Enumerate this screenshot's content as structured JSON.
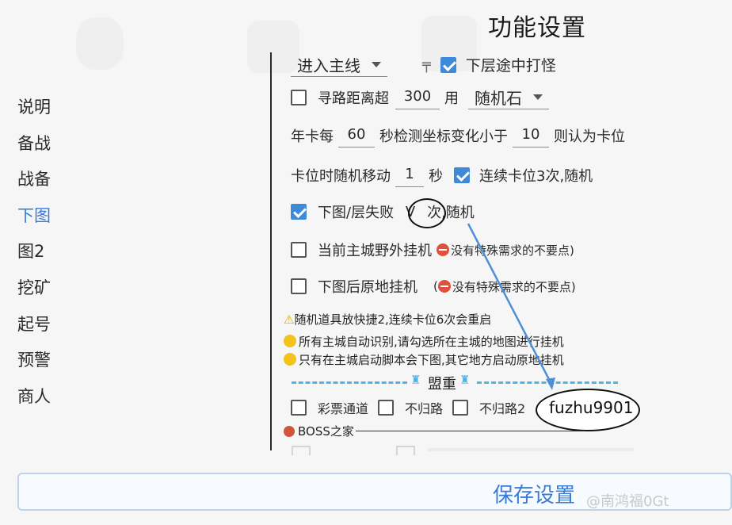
{
  "page": {
    "title": "功能设置"
  },
  "sidebar": {
    "items": [
      {
        "label": "说明"
      },
      {
        "label": "备战"
      },
      {
        "label": "战备"
      },
      {
        "label": "下图"
      },
      {
        "label": "图2"
      },
      {
        "label": "挖矿"
      },
      {
        "label": "起号"
      },
      {
        "label": "预警"
      },
      {
        "label": "商人"
      }
    ],
    "active_index": 3
  },
  "form": {
    "mode_select": {
      "value": "进入主线"
    },
    "fight_midway": {
      "label": "下层途中打怪",
      "checked": true
    },
    "pathfind": {
      "checked": false,
      "label_prefix": "寻路距离超",
      "distance": "300",
      "label_use": "用",
      "item": "随机石"
    },
    "stuck_detect": {
      "prefix": "年卡每",
      "seconds": "60",
      "middle": "秒检测坐标变化小于",
      "threshold": "10",
      "suffix": "则认为卡位"
    },
    "stuck_move": {
      "prefix": "卡位时随机移动",
      "seconds": "1",
      "unit": "秒",
      "consecutive": {
        "label": "连续卡位3次,随机",
        "checked": true
      }
    },
    "map_fail": {
      "checked": true,
      "label_prefix": "下图/层失败",
      "value": "V",
      "label_suffix": "次,随机"
    },
    "wild_afk": {
      "checked": false,
      "label": "当前主城野外挂机",
      "hint": "没有特殊需求的不要点)"
    },
    "stay_afk": {
      "checked": false,
      "label": "下图后原地挂机",
      "hint": "没有特殊需求的不要点)",
      "hint_prefix": "("
    },
    "notes": [
      "随机道具放快捷2,连续卡位6次会重启",
      "所有主城自动识别,请勾选所在主城的地图进行挂机",
      "只有在主城启动脚本会下图,其它地方启动原地挂机"
    ],
    "alliance": {
      "label": "盟重"
    },
    "routes": [
      {
        "label": "彩票通道",
        "checked": false
      },
      {
        "label": "不归路",
        "checked": false
      },
      {
        "label": "不归路2",
        "checked": false
      }
    ],
    "contact": "fuzhu9901",
    "boss_section": "BOSS之家"
  },
  "footer": {
    "save_label": "保存设置",
    "watermark": "@南鸿福0Gt"
  },
  "colors": {
    "accent": "#3a7bd5",
    "checkbox": "#3d8bd8",
    "dash": "#52b3e8"
  }
}
